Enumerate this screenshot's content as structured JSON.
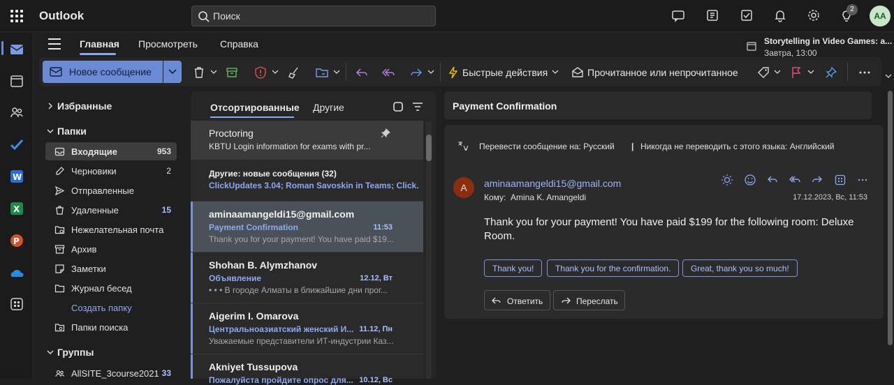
{
  "app": {
    "title": "Outlook"
  },
  "search": {
    "placeholder": "Поиск"
  },
  "topbar": {
    "notification_count": "2",
    "avatar_initials": "AA"
  },
  "ribbon": {
    "tabs": [
      "Главная",
      "Просмотреть",
      "Справка"
    ],
    "reminder": {
      "title": "Storytelling in Video Games: a...",
      "time": "Завтра, 13:00"
    },
    "new_message_label": "Новое сообщение",
    "quick_actions_label": "Быстрые действия",
    "read_unread_label": "Прочитанное или непрочитанное"
  },
  "folders": {
    "favorites_label": "Избранные",
    "folders_label": "Папки",
    "groups_label": "Группы",
    "items": [
      {
        "label": "Входящие",
        "count": "953",
        "icon": "inbox-icon",
        "selected": true
      },
      {
        "label": "Черновики",
        "count": "2",
        "icon": "draft-icon"
      },
      {
        "label": "Отправленные",
        "count": "",
        "icon": "send-icon"
      },
      {
        "label": "Удаленные",
        "count": "15",
        "icon": "trash-icon"
      },
      {
        "label": "Нежелательная почта",
        "count": "",
        "icon": "junk-icon"
      },
      {
        "label": "Архив",
        "count": "",
        "icon": "archive-icon"
      },
      {
        "label": "Заметки",
        "count": "",
        "icon": "note-icon"
      },
      {
        "label": "Журнал бесед",
        "count": "",
        "icon": "folder-icon"
      }
    ],
    "create_folder_label": "Создать папку",
    "search_folders_label": "Папки поиска",
    "group_item": {
      "label": "AllSITE_3course2021",
      "count": "33"
    }
  },
  "message_list": {
    "tab_focused": "Отсортированные",
    "tab_other": "Другие",
    "messages": [
      {
        "from": "Proctoring",
        "subject": "",
        "date": "",
        "preview": "KBTU Login information for exams with pr..."
      },
      {
        "from": "Другие: новые сообщения (32)",
        "subject": "ClickUpdates 3.04; Roman Savoskin in Teams; Click...",
        "date": "",
        "preview": ""
      },
      {
        "from": "aminaamangeldi15@gmail.com",
        "subject": "Payment Confirmation",
        "date": "11:53",
        "preview": "Thank you for your payment! You have paid $19..."
      },
      {
        "from": "Shohan B. Alymzhanov",
        "subject": "Объявление",
        "date": "12.12, Вт",
        "preview": "• • • В городе Алматы в ближайшие дни прог..."
      },
      {
        "from": "Aigerim I. Omarova",
        "subject": "Центральноазиатский женский И...",
        "date": "11.12, Пн",
        "preview": "Уважаемые представители ИТ-индустрии Каз..."
      },
      {
        "from": "Akniyet Tussupova",
        "subject": "Пожалуйста пройдите опрос для...",
        "date": "10.12, Вс",
        "preview": ""
      }
    ]
  },
  "reading_pane": {
    "subject": "Payment Confirmation",
    "translate_prompt": "Перевести сообщение на: Русский",
    "translate_separator": "|",
    "never_translate": "Никогда не переводить с этого языка: Английский",
    "sender_initial": "A",
    "sender": "aminaamangeldi15@gmail.com",
    "to_label": "Кому:",
    "to_name": "Amina K. Amangeldi",
    "date": "17.12.2023, Вс, 11:53",
    "body": "Thank you for your payment! You have paid $199 for the following room: Deluxe Room.",
    "quick_replies": [
      "Thank you!",
      "Thank you for the confirmation.",
      "Great, thank you so much!"
    ],
    "reply_label": "Ответить",
    "forward_label": "Переслать"
  },
  "colors": {
    "accent": "#6b8ad6",
    "link": "#9bb5f5",
    "background": "#1f1f1f"
  }
}
